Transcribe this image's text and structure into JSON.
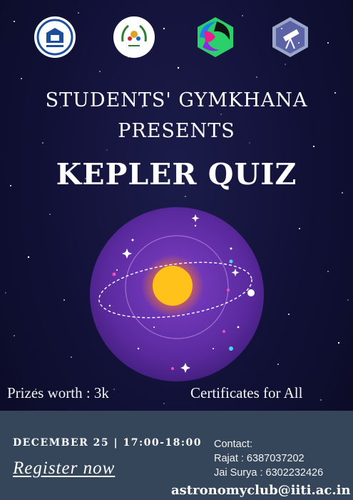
{
  "logos": [
    {
      "icon": "institute-crest-icon"
    },
    {
      "icon": "gymkhana-emblem-icon"
    },
    {
      "icon": "club-hexagon-logo-icon"
    },
    {
      "icon": "astronomy-club-telescope-icon"
    }
  ],
  "header": {
    "line1": "STUDENTS' GYMKHANA",
    "line2": "PRESENTS",
    "title": "KEPLER QUIZ"
  },
  "illustration": {
    "icon": "solar-orbit-illustration-icon",
    "colors": {
      "disc": "#5b2a9e",
      "sun": "#ffc21a",
      "glow": "#ff7a1a"
    }
  },
  "taglines": {
    "prizes": "Prizes worth : 3k",
    "certificates": "Certificates for All"
  },
  "footer": {
    "date_time": "DECEMBER 25 | 17:00-18:00",
    "register_label": "Register now",
    "contact_heading": "Contact:",
    "contacts": [
      "Rajat : 6387037202",
      "Jai Surya : 6302232426"
    ],
    "email": "astronomyclub@iiti.ac.in",
    "background": "#35465b"
  }
}
